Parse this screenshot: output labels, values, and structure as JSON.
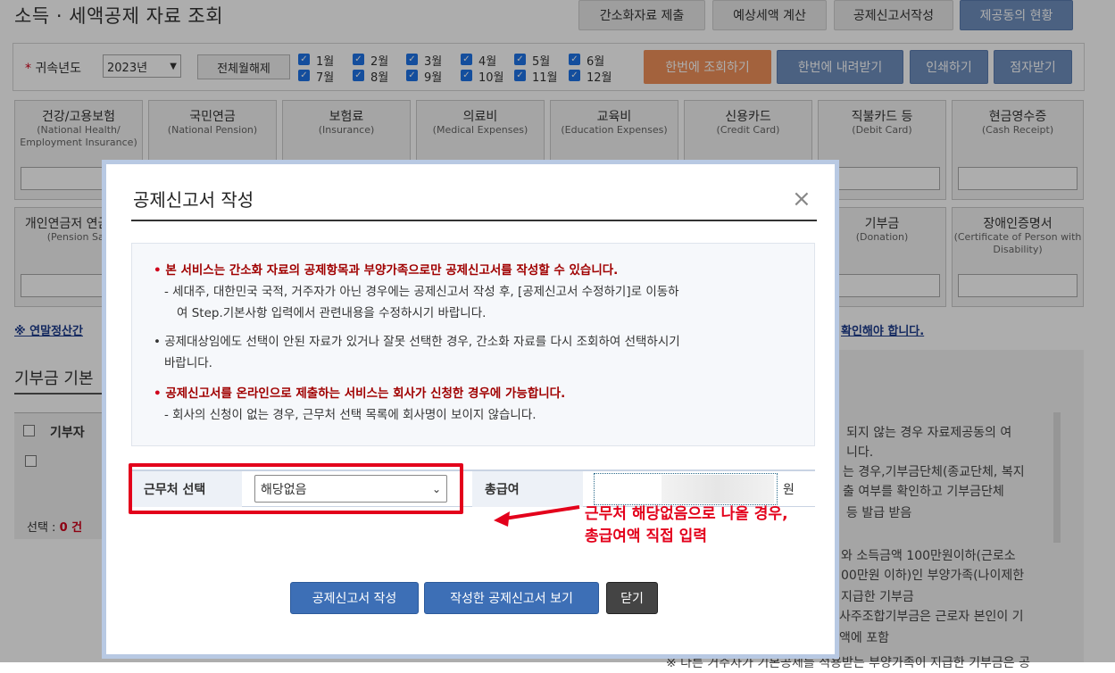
{
  "page_title": "소득 · 세액공제 자료 조회",
  "top_buttons": [
    "간소화자료 제출",
    "예상세액 계산",
    "공제신고서작성",
    "제공동의 현황"
  ],
  "filter": {
    "year_label": "귀속년도",
    "year_value": "2023년",
    "deselect_all": "전체월해제",
    "months_row1": [
      "1월",
      "2월",
      "3월",
      "4월",
      "5월",
      "6월"
    ],
    "months_row2": [
      "7월",
      "8월",
      "9월",
      "10월",
      "11월",
      "12월"
    ],
    "actions": [
      "한번에 조회하기",
      "한번에 내려받기",
      "인쇄하기",
      "점자받기"
    ]
  },
  "cards_row1": [
    {
      "title": "건강/고용보험",
      "sub": "(National Health/ Employment Insurance)"
    },
    {
      "title": "국민연금",
      "sub": "(National Pension)"
    },
    {
      "title": "보험료",
      "sub": "(Insurance)"
    },
    {
      "title": "의료비",
      "sub": "(Medical Expenses)"
    },
    {
      "title": "교육비",
      "sub": "(Education Expenses)"
    },
    {
      "title": "신용카드",
      "sub": "(Credit Card)"
    },
    {
      "title": "직불카드 등",
      "sub": "(Debit Card)"
    },
    {
      "title": "현금영수증",
      "sub": "(Cash Receipt)"
    }
  ],
  "cards_row2": [
    {
      "title": "개인연금저 연금계조",
      "sub": "(Pension Sav"
    },
    {
      "title": "기부금",
      "sub": "(Donation)"
    },
    {
      "title": "장애인증명서",
      "sub": "(Certificate of Person with Disability)"
    }
  ],
  "background": {
    "note_left": "※ 연말정산간",
    "note_right": "확인해야 합니다.",
    "donation_title": "기부금 기본",
    "col_donor": "기부자",
    "selection_label": "선택 : ",
    "selection_count": "0 건",
    "right_text": [
      "되지 않는 경우 자료제공동의 여",
      "니다.",
      "는 경우,기부금단체(종교단체, 복지",
      "출 여부를 확인하고 기부금단체",
      "등 발급 받음",
      "와 소득금액 100만원이하(근로소",
      "00만원 이하)인 부양가족(나이제한",
      "지급한 기부금",
      "사주조합기부금은 근로자 본인이 기",
      "액에 포함",
      "※ 다른 거주자가 기본공제를 적용받는 부양가족이 지급한 기부금은 공"
    ]
  },
  "modal": {
    "title": "공제신고서 작성",
    "close_symbol": "×",
    "notices": [
      {
        "head": "본 서비스는 간소화 자료의 공제항목과 부양가족으로만 공제신고서를 작성할 수 있습니다.",
        "lines": [
          "- 세대주, 대한민국 국적, 거주자가 아닌 경우에는 공제신고서 작성 후, [공제신고서 수정하기]로 이동하",
          "여 Step.기본사항 입력에서 관련내용을 수정하시기 바랍니다."
        ]
      },
      {
        "head": "공제대상임에도 선택이 안된 자료가 있거나 잘못 선택한 경우, 간소화 자료를 다시 조회하여 선택하시기",
        "lines": [
          "바랍니다."
        ]
      },
      {
        "head": "공제신고서를 온라인으로 제출하는 서비스는 회사가 신청한 경우에 가능합니다.",
        "lines": [
          "- 회사의 신청이 없는 경우, 근무처 선택 목록에 회사명이 보이지 않습니다."
        ]
      }
    ],
    "workplace_label": "근무처 선택",
    "workplace_value": "해당없음",
    "salary_label": "총급여",
    "salary_unit": "원",
    "annotation_line1": "근무처 해당없음으로 나올 경우,",
    "annotation_line2": "총급여액 직접 입력",
    "buttons": [
      "공제신고서 작성",
      "작성한 공제신고서 보기",
      "닫기"
    ]
  },
  "colors": {
    "accent_red": "#e3001b",
    "button_blue": "#3d6fb6",
    "top_blue": "#6f8fbf",
    "orange": "#f0915a"
  }
}
